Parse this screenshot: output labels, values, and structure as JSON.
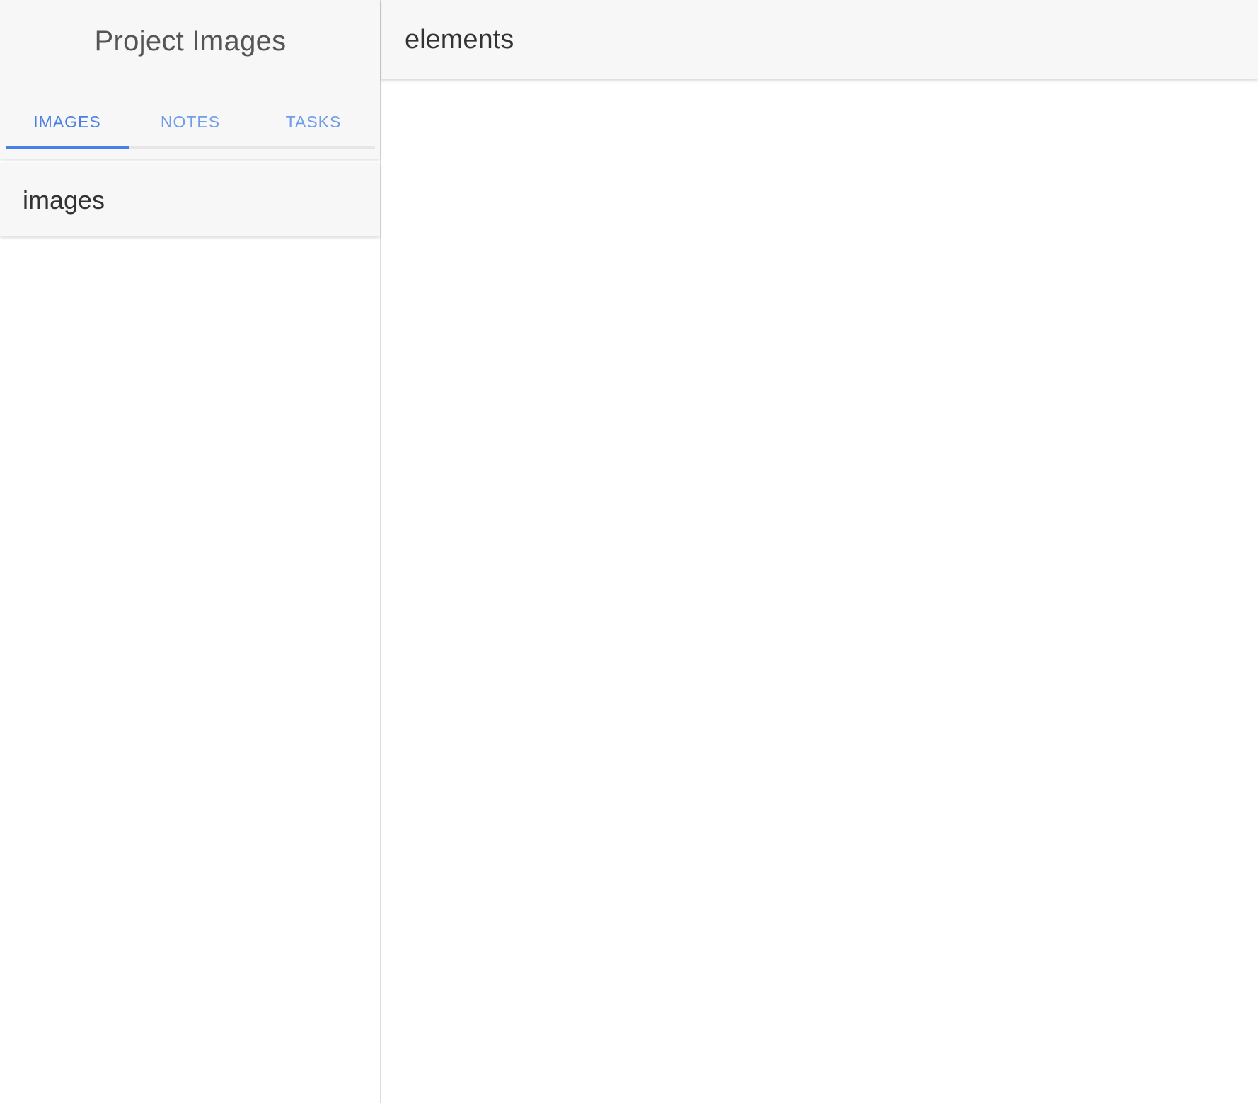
{
  "sidebar": {
    "app_title": "Project Images",
    "tabs": [
      {
        "label": "IMAGES",
        "active": true
      },
      {
        "label": "NOTES",
        "active": false
      },
      {
        "label": "TASKS",
        "active": false
      }
    ],
    "section_title": "images"
  },
  "main": {
    "title": "elements"
  },
  "colors": {
    "accent": "#4a80e3",
    "tab_inactive": "#6f9de8",
    "header_bg": "#f7f7f7",
    "text": "#333333"
  }
}
